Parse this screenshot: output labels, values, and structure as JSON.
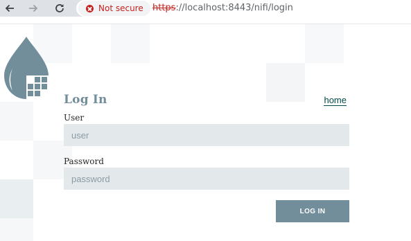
{
  "browser": {
    "security_label": "Not secure",
    "url_scheme": "https",
    "url_rest": "://localhost:8443/nifi/login",
    "icons": [
      "back-arrow-icon",
      "forward-arrow-icon",
      "reload-icon",
      "warning-icon"
    ]
  },
  "login": {
    "title": "Log In",
    "home_link": "home",
    "user_label": "User",
    "user_placeholder": "user",
    "password_label": "Password",
    "password_placeholder": "password",
    "submit_label": "LOG IN"
  },
  "colors": {
    "accent": "#728e9b",
    "input_bg": "#e3e8eb",
    "link": "#004849",
    "warning": "#c5221f"
  }
}
